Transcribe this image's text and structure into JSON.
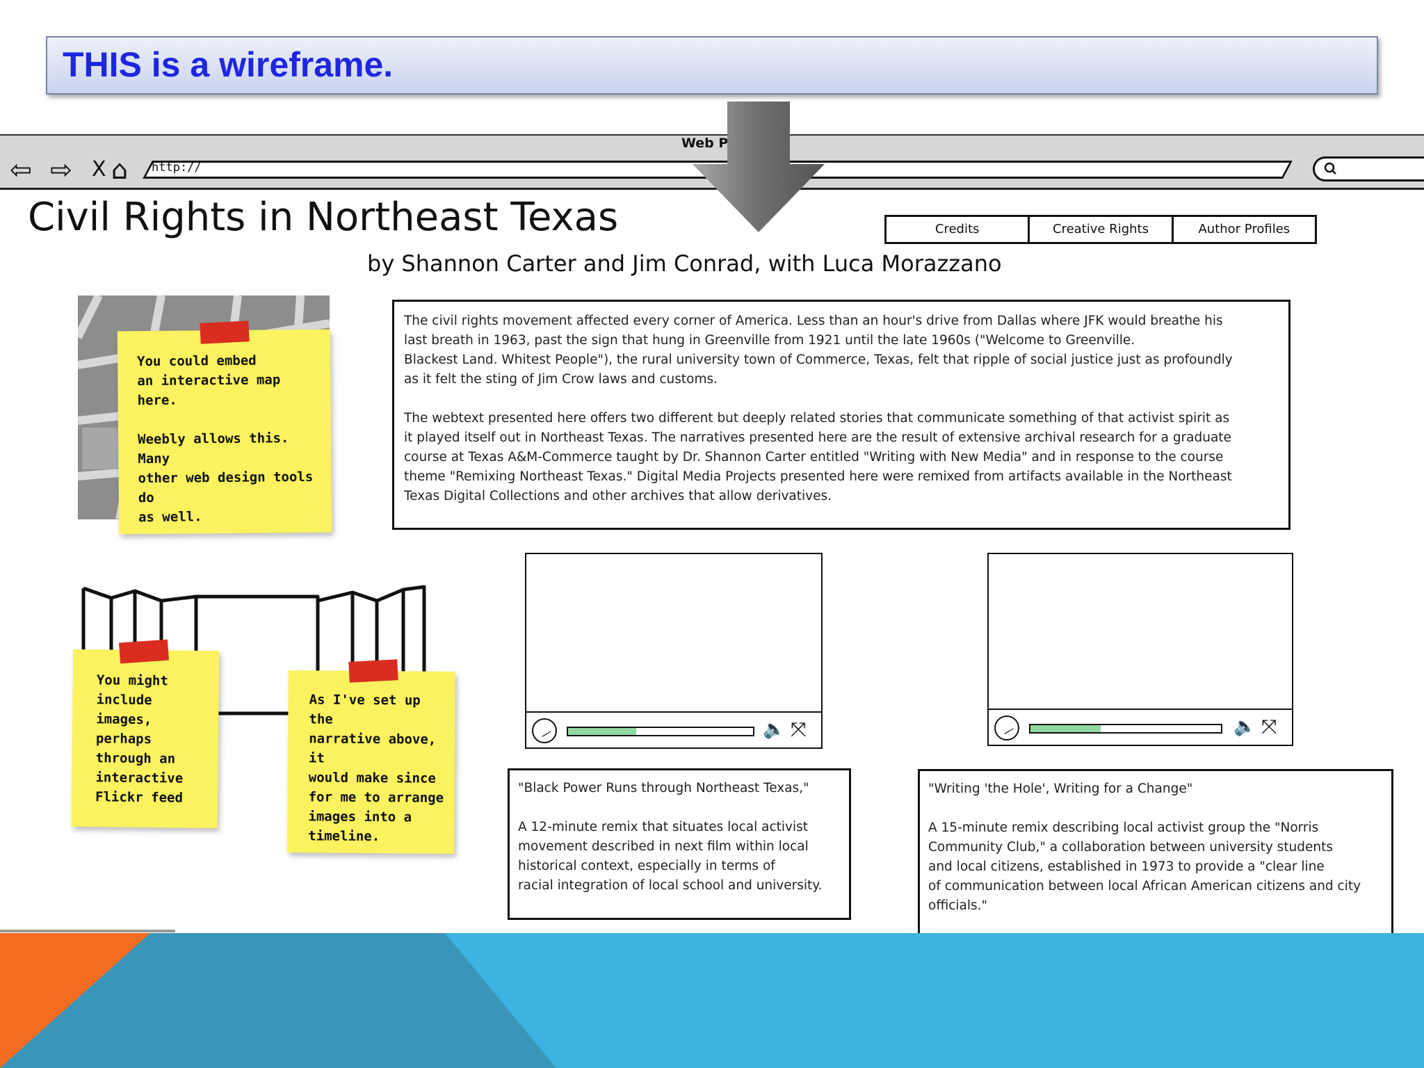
{
  "banner": {
    "text": "THIS is a wireframe."
  },
  "browser": {
    "title": "Web P",
    "address": "http://",
    "nav": {
      "back": "⇦",
      "forward": "⇨",
      "stop": "X",
      "home": "⌂"
    }
  },
  "page": {
    "title": "Civil Rights in Northeast Texas",
    "byline": "by Shannon Carter and Jim Conrad, with Luca Morazzano",
    "nav_items": [
      "Credits",
      "Creative Rights",
      "Author Profiles"
    ],
    "intro_paragraph_1": "The civil rights movement affected every corner of America. Less than an hour's drive from Dallas where JFK would breathe his\nlast breath in 1963, past the sign that hung in Greenville from 1921 until the late 1960s (\"Welcome to Greenville.\nBlackest Land. Whitest People\"), the rural university town of Commerce, Texas, felt that ripple of social justice just as profoundly\nas it felt the sting of Jim Crow laws and customs.",
    "intro_paragraph_2": "The webtext presented here offers two different but deeply related stories that communicate something of that activist spirit as\nit played itself out in Northeast Texas. The narratives presented here are the result of extensive archival research for a graduate\ncourse at Texas A&M-Commerce taught by Dr. Shannon Carter entitled \"Writing with New Media\" and in response to the course\ntheme \"Remixing Northeast Texas.\" Digital Media Projects presented here were remixed from artifacts available in the Northeast\nTexas Digital Collections and other archives that allow derivatives."
  },
  "notes": {
    "map_note": "You could embed\nan interactive map here.\n\nWeebly allows this. Many\nother web design tools do\nas well.",
    "images_note": "You might\ninclude images,\nperhaps\nthrough an\ninteractive\nFlickr feed",
    "timeline_note": "As I've set up the\nnarrative above, it\nwould make since\nfor me to arrange\nimages into a\ntimeline."
  },
  "videos": [
    {
      "progress": 0.37,
      "title": "\"Black Power Runs through Northeast Texas,\"",
      "description": "A 12-minute remix that situates local activist\nmovement described in next film within local\nhistorical context, especially in terms of\nracial integration of local school and university."
    },
    {
      "progress": 0.37,
      "title": "\"Writing 'the Hole', Writing for a Change\"",
      "description": "A 15-minute remix describing local activist group the \"Norris\nCommunity Club,\" a collaboration between university students\nand local citizens, established in 1973 to provide a \"clear line\nof communication between local African American citizens and city\nofficials.\""
    }
  ],
  "icons": {
    "play": "play-icon",
    "volume": "🔈",
    "fullscreen": "⤧",
    "search": "🔍"
  },
  "colors": {
    "banner_text": "#1f26e0",
    "sticky": "#fbf25f",
    "tape": "#d92d20",
    "progress": "#8fd8a0",
    "deco_blue": "#3cb3e0",
    "deco_orange": "#f36c21"
  }
}
